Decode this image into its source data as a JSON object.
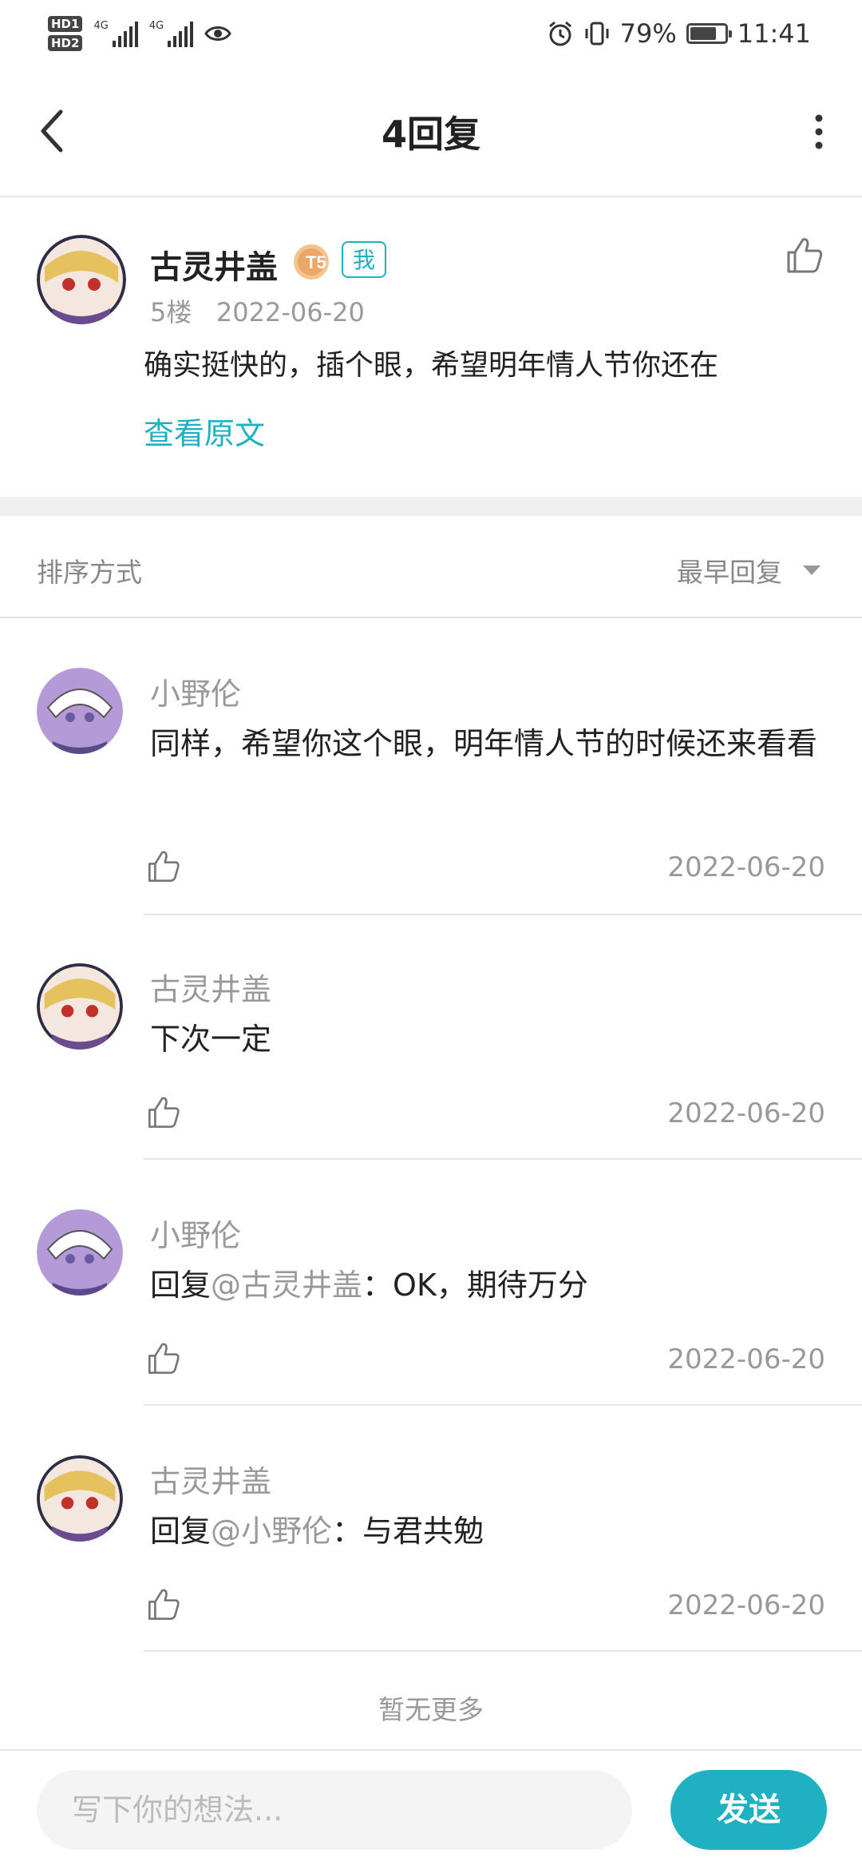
{
  "status_bar": {
    "hd1": "HD1",
    "hd2": "HD2",
    "signal1": "4G",
    "signal2": "4G",
    "battery": "79%",
    "battery_level": 0.79,
    "time": "11:41"
  },
  "header": {
    "title": "4回复",
    "icons": [
      "back-arrow-icon",
      "more-vertical-icon"
    ]
  },
  "post": {
    "author": "古灵井盖",
    "level_badge": "T5",
    "me_badge": "我",
    "floor": "5楼",
    "date": "2022-06-20",
    "text": "确实挺快的，插个眼，希望明年情人节你还在",
    "view_original": "查看原文"
  },
  "sort": {
    "label": "排序方式",
    "value": "最早回复"
  },
  "replies": [
    {
      "author": "小野伦",
      "prefix": "",
      "mention": "",
      "text": "同样，希望你这个眼，明年情人节的时候还来看看",
      "date": "2022-06-20"
    },
    {
      "author": "古灵井盖",
      "prefix": "",
      "mention": "",
      "text": "下次一定",
      "date": "2022-06-20"
    },
    {
      "author": "小野伦",
      "prefix": "回复",
      "mention": "@古灵井盖",
      "text": "：OK，期待万分",
      "date": "2022-06-20"
    },
    {
      "author": "古灵井盖",
      "prefix": "回复",
      "mention": "@小野伦",
      "text": "：与君共勉",
      "date": "2022-06-20"
    }
  ],
  "no_more": "暂无更多",
  "bottom": {
    "placeholder": "写下你的想法...",
    "send": "发送"
  },
  "colors": {
    "accent": "#1fb1c1",
    "muted": "#999999",
    "text": "#222222"
  }
}
